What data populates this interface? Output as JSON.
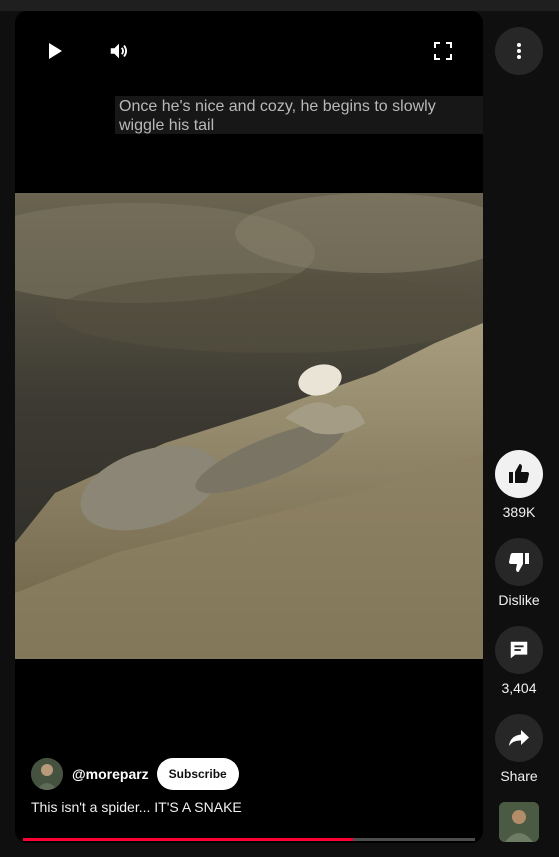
{
  "player": {
    "caption": "Once he's nice and cozy, he begins to slowly wiggle his tail",
    "icons": {
      "play": "play-icon",
      "volume": "volume-icon",
      "fullscreen": "fullscreen-icon"
    },
    "progress": 0.73
  },
  "channel": {
    "handle": "@moreparz",
    "subscribe_label": "Subscribe"
  },
  "video": {
    "title": "This isn't a spider... IT'S A SNAKE"
  },
  "actions": {
    "like_count": "389K",
    "dislike_label": "Dislike",
    "comment_count": "3,404",
    "share_label": "Share"
  },
  "colors": {
    "background": "#0f0f0f",
    "progress": "#ff0033",
    "button": "#272727"
  }
}
